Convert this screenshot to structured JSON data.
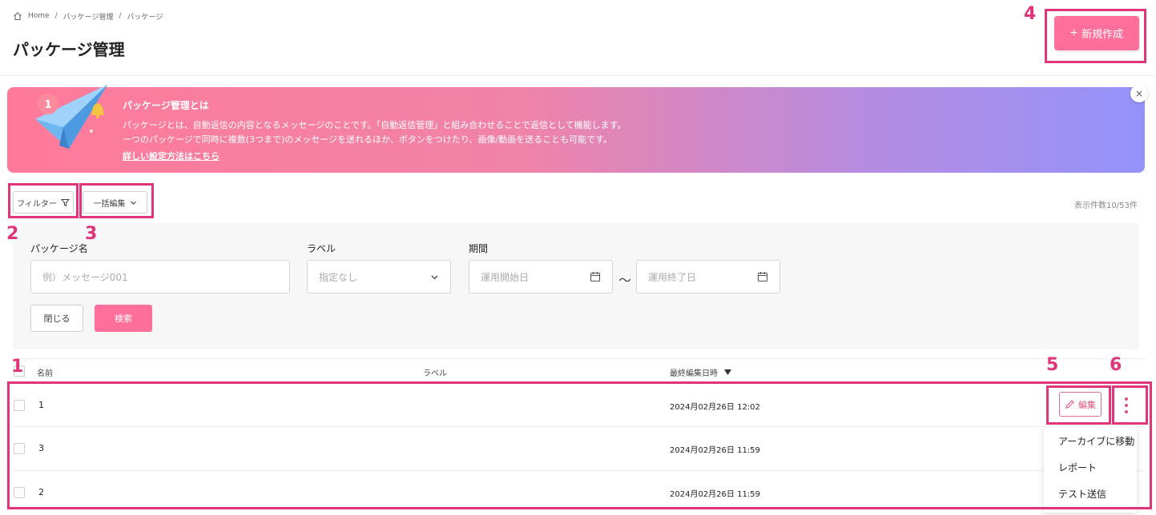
{
  "breadcrumb": {
    "home": "Home",
    "sep": "/",
    "items": [
      "パッケージ管理",
      "パッケージ"
    ]
  },
  "page": {
    "title": "パッケージ管理",
    "create_label": "新規作成",
    "create_icon": "plus-icon"
  },
  "banner": {
    "title": "パッケージ管理とは",
    "line1": "パッケージとは、自動返信の内容となるメッセージのことです。「自動返信管理」と組み合わせることで返信として機能します。",
    "line2": "一つのパッケージで同時に複数(3つまで)のメッセージを送れるほか、ボタンをつけたり、画像/動画を送ることも可能です。",
    "link": "詳しい設定方法はこちら",
    "close": "×",
    "badge": "1"
  },
  "toolbar": {
    "filter_label": "フィルター",
    "bulk_edit_label": "一括編集",
    "count_text": "表示件数10/53件"
  },
  "filter": {
    "name_label": "パッケージ名",
    "name_placeholder": "例）メッセージ001",
    "label_label": "ラベル",
    "label_selected": "指定なし",
    "period_label": "期間",
    "start_placeholder": "運用開始日",
    "end_placeholder": "運用終了日",
    "tilde": "〜",
    "close_label": "閉じる",
    "search_label": "検索"
  },
  "table": {
    "headers": {
      "name": "名前",
      "label": "ラベル",
      "updated": "最終編集日時"
    },
    "rows": [
      {
        "name": "1",
        "label": "",
        "updated": "2024月02月26日 12:02"
      },
      {
        "name": "3",
        "label": "",
        "updated": "2024月02月26日 11:59"
      },
      {
        "name": "2",
        "label": "",
        "updated": "2024月02月26日 11:59"
      }
    ],
    "edit_label": "編集"
  },
  "dropdown": {
    "items": [
      "アーカイブに移動",
      "レポート",
      "テスト送信"
    ]
  },
  "annotations": [
    "1",
    "2",
    "3",
    "4",
    "5",
    "6"
  ],
  "colors": {
    "accent": "#ff6f9c",
    "annotation": "#e0357a",
    "banner_start": "#ff7a9a",
    "banner_end": "#9493fb"
  }
}
